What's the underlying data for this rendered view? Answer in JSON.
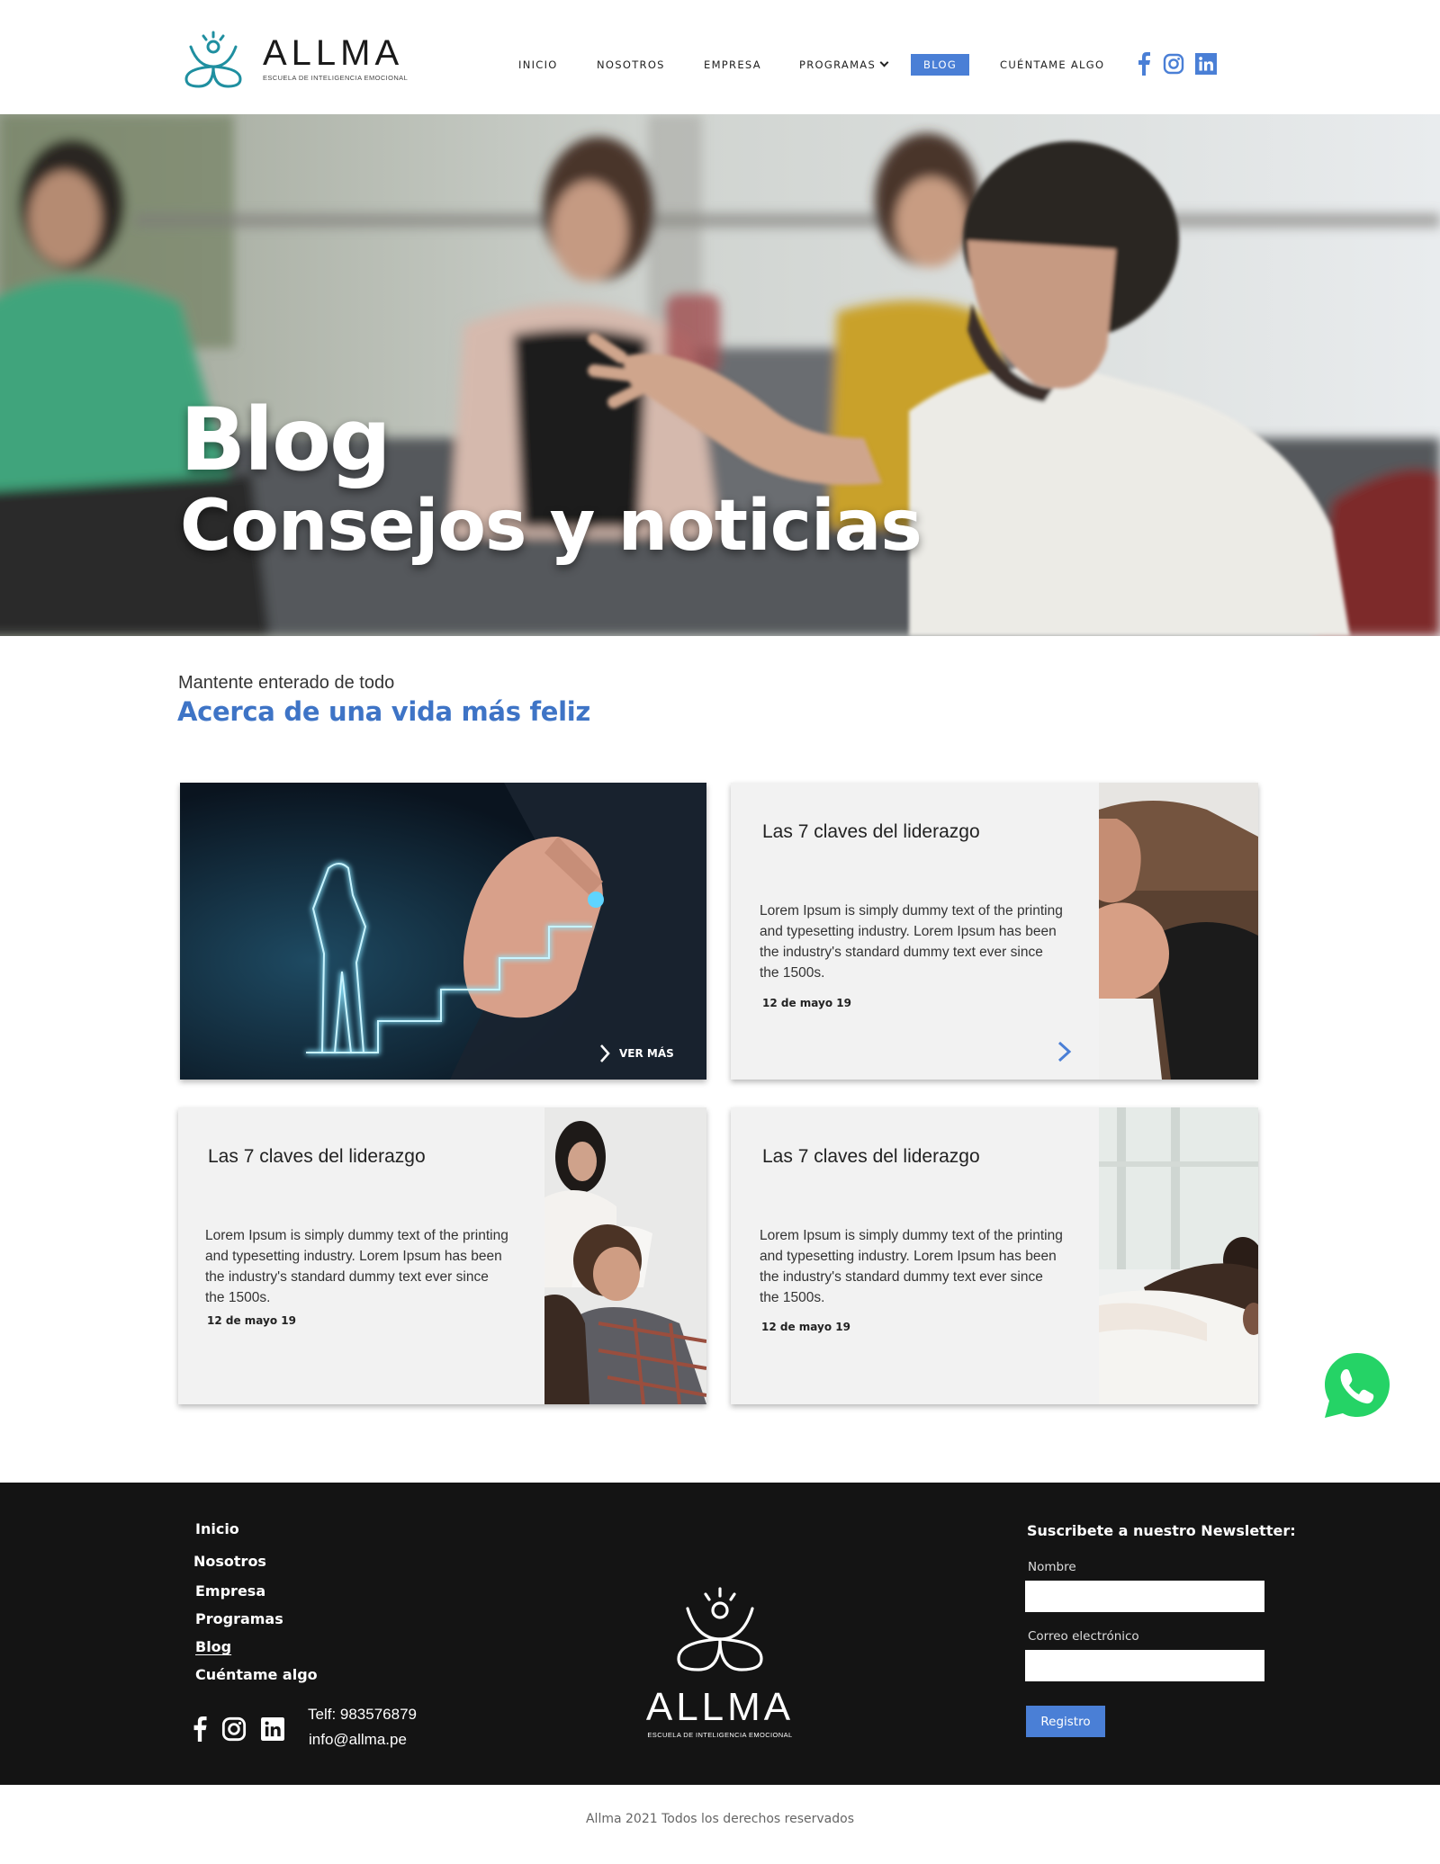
{
  "header": {
    "logo": {
      "name": "ALLMA",
      "tagline": "ESCUELA DE INTELIGENCIA EMOCIONAL"
    },
    "nav": [
      {
        "label": "INICIO"
      },
      {
        "label": "NOSOTROS"
      },
      {
        "label": "EMPRESA"
      },
      {
        "label": "PROGRAMAS"
      },
      {
        "label": "BLOG",
        "active": true
      },
      {
        "label": "CUÉNTAME ALGO"
      }
    ],
    "social": [
      "facebook-icon",
      "instagram-icon",
      "linkedin-icon"
    ]
  },
  "hero": {
    "title_line1": "Blog",
    "title_line2": "Consejos y noticias"
  },
  "intro": {
    "subtitle": "Mantente enterado de todo",
    "title": "Acerca de una vida más feliz"
  },
  "posts": [
    {
      "image": "leadership-stairs-image",
      "cta": "VER MÁS"
    },
    {
      "title": "Las 7 claves del liderazgo",
      "body": "Lorem Ipsum is simply dummy text of the printing and typesetting industry. Lorem Ipsum has been the industry's standard dummy text ever since the 1500s.",
      "date": "12 de mayo 19",
      "image": "handshake-image"
    },
    {
      "title": "Las 7 claves del liderazgo",
      "body": "Lorem Ipsum is simply dummy text of the printing and typesetting industry. Lorem Ipsum has been the industry's standard dummy text ever since the 1500s.",
      "date": "12 de mayo 19",
      "image": "meeting-people-image"
    },
    {
      "title": "Las 7 claves del liderazgo",
      "body": "Lorem Ipsum is simply dummy text of the printing and typesetting industry. Lorem Ipsum has been the industry's standard dummy text ever since the 1500s.",
      "date": "12 de mayo 19",
      "image": "office-team-image"
    }
  ],
  "footer": {
    "links": [
      "Inicio",
      "Nosotros",
      "Empresa",
      "Programas",
      "Blog",
      "Cuéntame algo"
    ],
    "phone": "Telf: 983576879",
    "email": "info@allma.pe",
    "logo": {
      "name": "ALLMA",
      "tagline": "ESCUELA DE INTELIGENCIA EMOCIONAL"
    },
    "newsletter": {
      "title": "Suscribete a nuestro Newsletter:",
      "name_label": "Nombre",
      "email_label": "Correo electrónico",
      "button": "Registro"
    }
  },
  "copyright": "Allma 2021 Todos los derechos reservados",
  "colors": {
    "accent": "#4a7fd6",
    "intro_title": "#3e74c6",
    "footer_bg": "#141414",
    "whatsapp": "#25d366"
  }
}
